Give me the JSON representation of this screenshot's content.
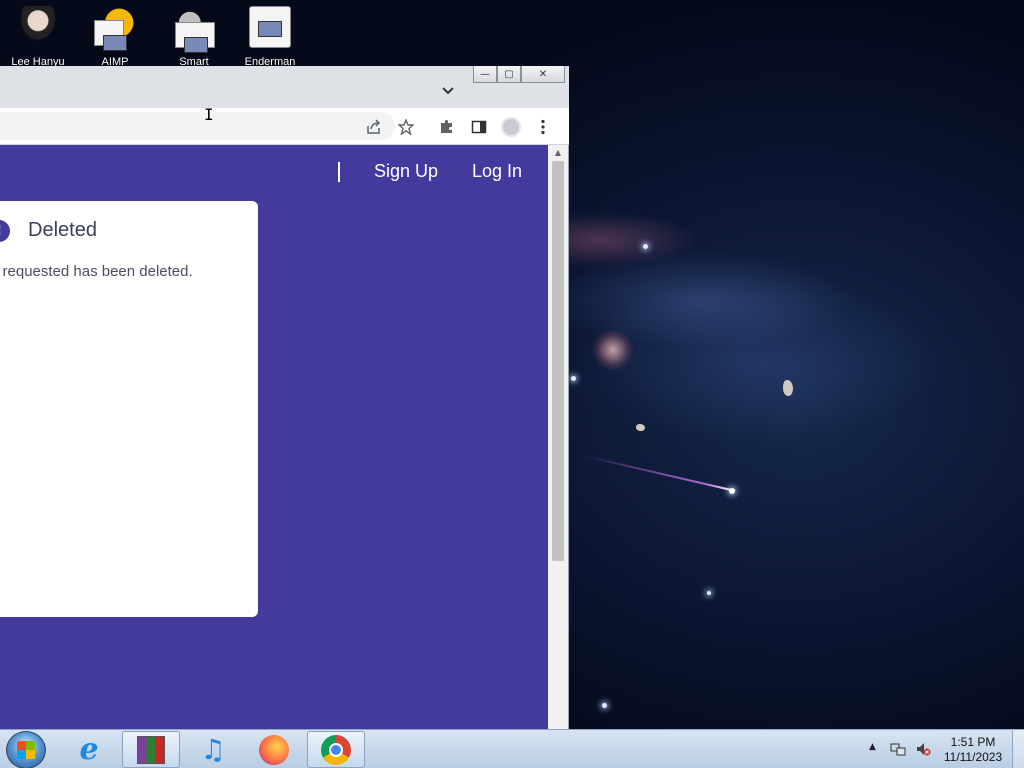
{
  "desktop": {
    "icons": [
      {
        "label": "Lee Hanyu",
        "icon": "person-icon"
      },
      {
        "label": "AIMP",
        "icon": "aimp-icon"
      },
      {
        "label": "Smart",
        "icon": "gear-doc-icon"
      },
      {
        "label": "Enderman",
        "icon": "document-icon"
      }
    ]
  },
  "browser": {
    "window_controls": {
      "minimize": "—",
      "maximize": "▢",
      "close": "✕"
    },
    "tab_dropdown": "⌄",
    "nav": {
      "signup": "Sign Up",
      "login": "Log In"
    },
    "card": {
      "alert_symbol": "!",
      "title": "Deleted",
      "message": "u requested has been deleted."
    },
    "scroll_up": "▲"
  },
  "taskbar": {
    "pinned": [
      "Internet Explorer",
      "WinRAR",
      "iTunes",
      "Firefox",
      "Chrome"
    ],
    "clock": {
      "time": "1:51 PM",
      "date": "11/11/2023"
    },
    "tray_arrow": "▲"
  }
}
